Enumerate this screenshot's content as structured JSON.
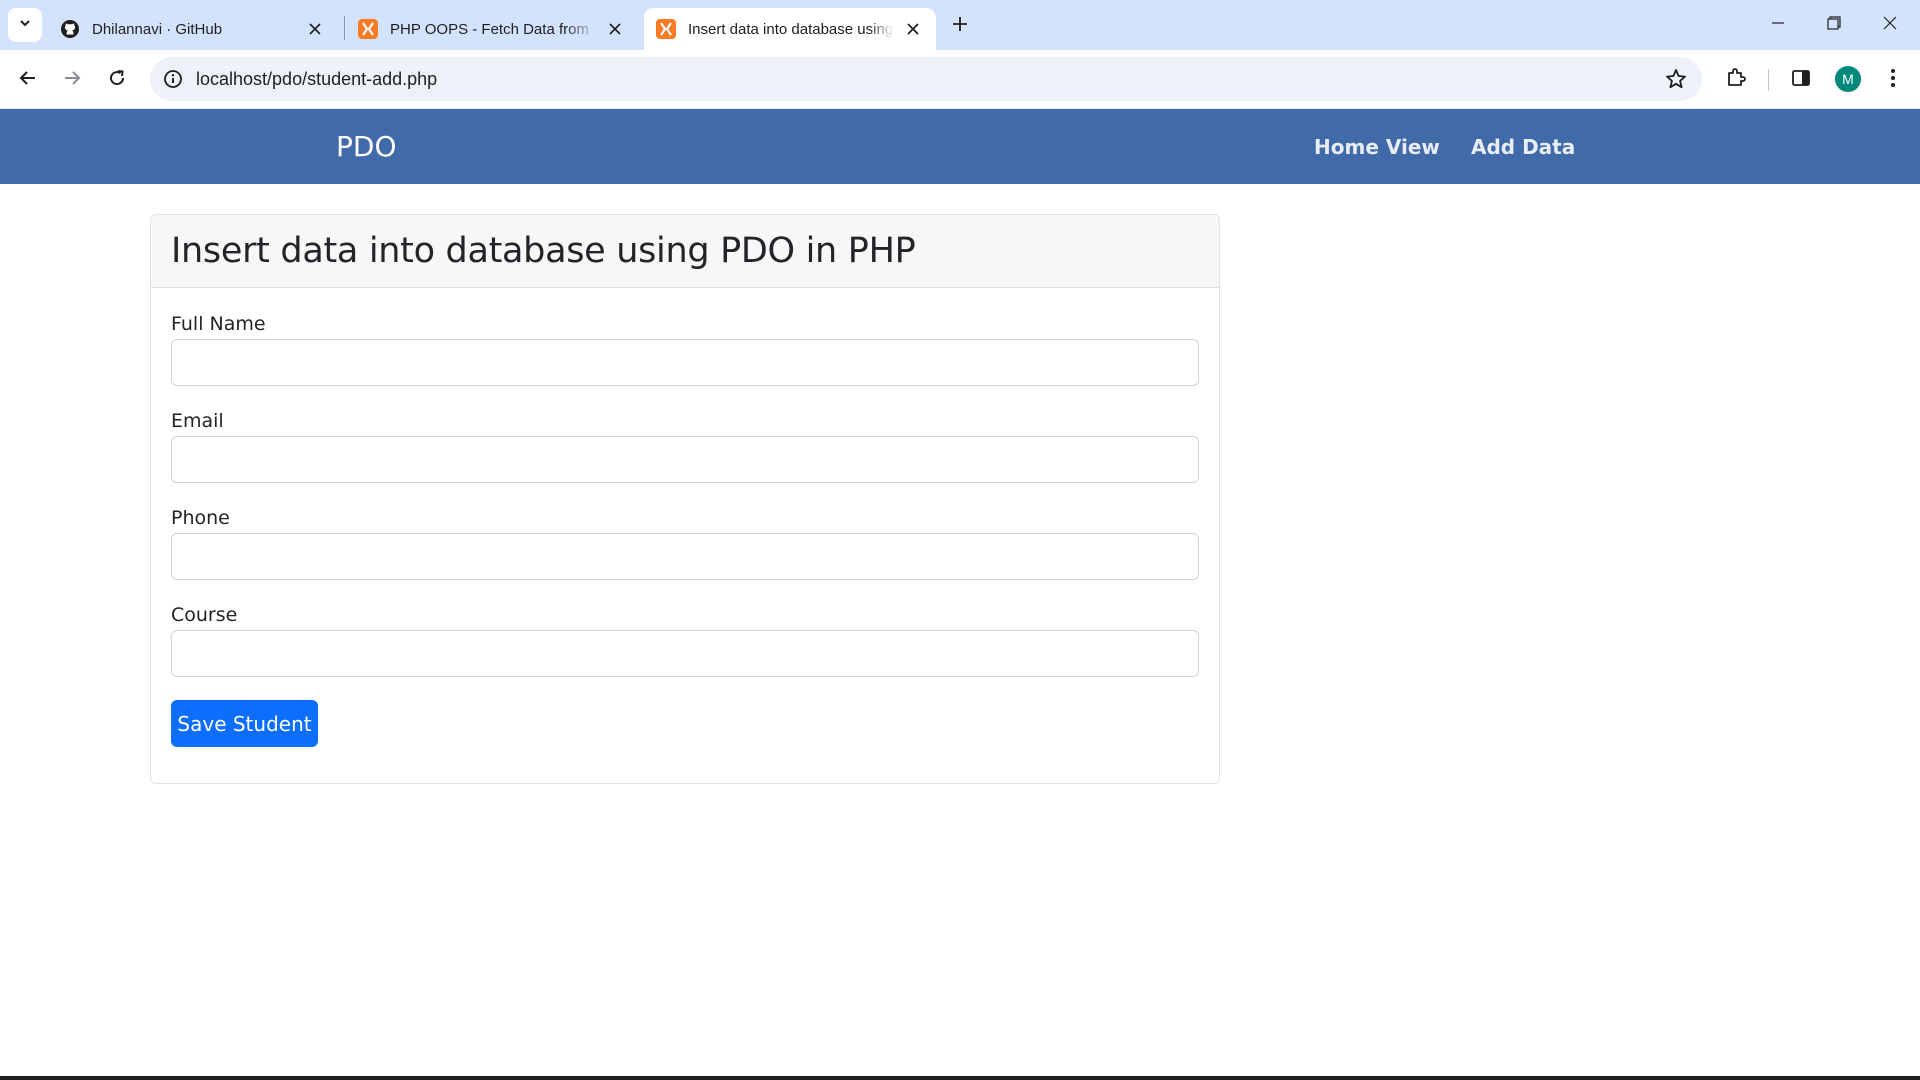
{
  "browser": {
    "tabs": [
      {
        "title": "Dhilannavi · GitHub",
        "favicon": "github-icon",
        "active": false
      },
      {
        "title": "PHP OOPS - Fetch Data from da",
        "favicon": "xampp-icon",
        "active": false
      },
      {
        "title": "Insert data into database using",
        "favicon": "xampp-icon",
        "active": true
      }
    ],
    "url": "localhost/pdo/student-add.php",
    "profile_initial": "M",
    "accent_color": "#d3e3fd",
    "avatar_color": "#00897b"
  },
  "navbar": {
    "brand": "PDO",
    "links": [
      "Home View",
      "Add Data"
    ],
    "background": "#416aa9"
  },
  "card": {
    "title": "Insert data into database using PDO in PHP"
  },
  "form": {
    "fields": [
      {
        "label": "Full Name",
        "value": ""
      },
      {
        "label": "Email",
        "value": ""
      },
      {
        "label": "Phone",
        "value": ""
      },
      {
        "label": "Course",
        "value": ""
      }
    ],
    "submit_label": "Save Student",
    "button_color": "#0d6efd"
  }
}
